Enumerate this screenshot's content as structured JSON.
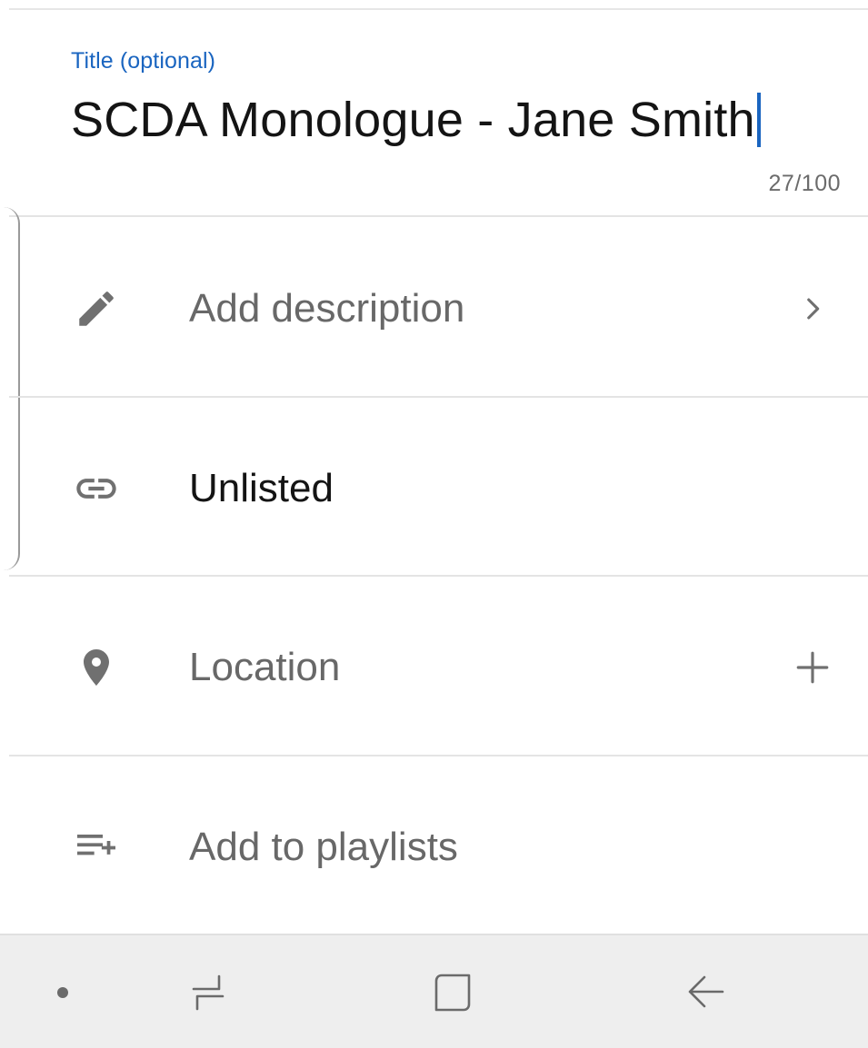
{
  "title_field": {
    "label": "Title (optional)",
    "value": "SCDA Monologue - Jane Smith",
    "counter": "27/100"
  },
  "rows": [
    {
      "icon": "pencil-icon",
      "label": "Add description",
      "trailing_icon": "chevron-right-icon"
    },
    {
      "icon": "link-icon",
      "label": "Unlisted",
      "trailing_icon": ""
    },
    {
      "icon": "location-pin-icon",
      "label": "Location",
      "trailing_icon": "plus-icon"
    },
    {
      "icon": "playlist-add-icon",
      "label": "Add to playlists",
      "trailing_icon": ""
    }
  ],
  "navbar": {
    "buttons": [
      "dot-icon",
      "recents-icon",
      "home-icon",
      "back-icon"
    ]
  },
  "colors": {
    "accent": "#1a65c0",
    "icon_gray": "#707070",
    "text_dark": "#141414",
    "text_gray": "#686868",
    "navbar_bg": "#eeeeee"
  }
}
